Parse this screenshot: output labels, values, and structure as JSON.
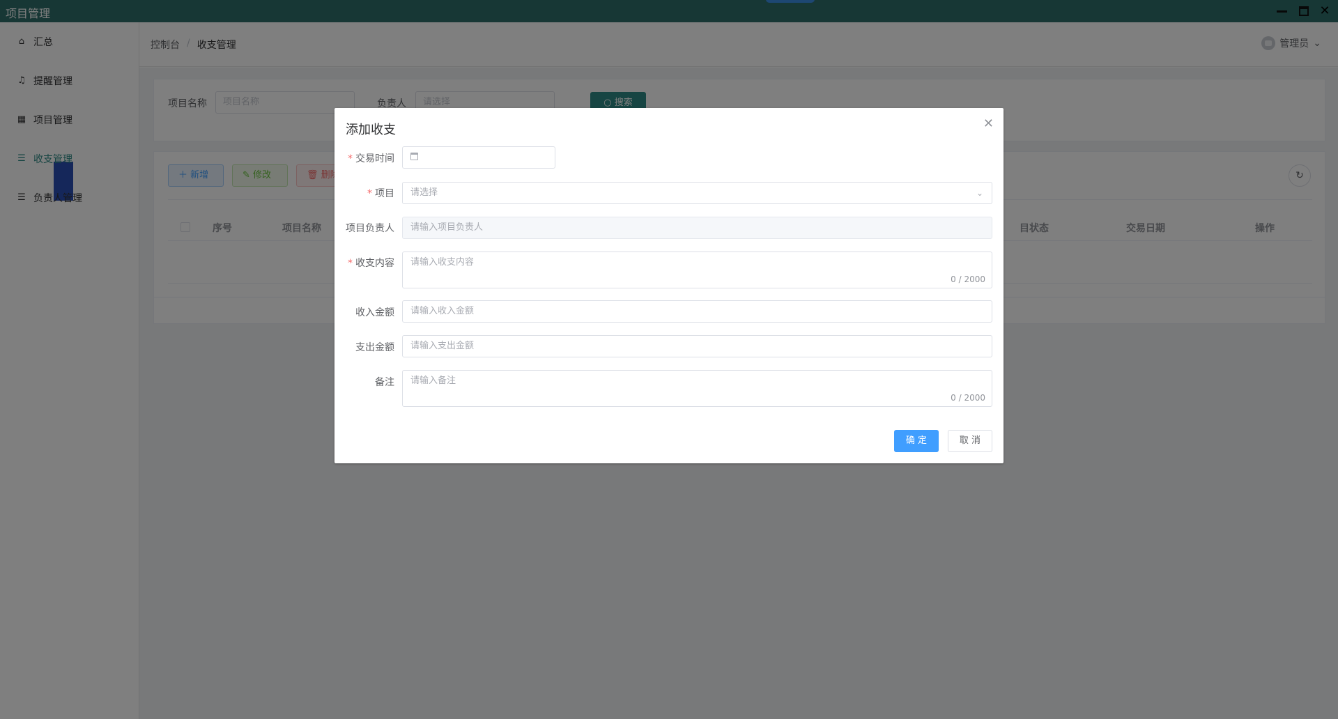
{
  "window": {
    "title": "项目管理"
  },
  "sidebar": {
    "items": [
      {
        "label": "汇总",
        "icon": "home-icon"
      },
      {
        "label": "提醒管理",
        "icon": "bell-icon"
      },
      {
        "label": "项目管理",
        "icon": "grid-icon"
      },
      {
        "label": "收支管理",
        "icon": "database-icon"
      },
      {
        "label": "负责人管理",
        "icon": "database-icon"
      }
    ]
  },
  "header": {
    "breadcrumb": [
      "控制台",
      "收支管理"
    ],
    "separator": "/",
    "user": "管理员"
  },
  "search": {
    "project_label": "项目名称",
    "project_placeholder": "项目名称",
    "owner_label": "负责人",
    "owner_placeholder": "请选择",
    "search_button": "搜索"
  },
  "toolbar": {
    "add": "新增",
    "edit": "修改",
    "delete": "删除"
  },
  "table": {
    "columns": [
      "序号",
      "项目名称",
      "目状态",
      "交易日期",
      "操作"
    ]
  },
  "dialog": {
    "title": "添加收支",
    "fields": {
      "trade_time_label": "交易时间",
      "project_label": "项目",
      "project_placeholder": "请选择",
      "owner_label": "项目负责人",
      "owner_placeholder": "请输入项目负责人",
      "content_label": "收支内容",
      "content_placeholder": "请输入收支内容",
      "content_count": "0 / 2000",
      "income_label": "收入金额",
      "income_placeholder": "请输入收入金额",
      "expense_label": "支出金额",
      "expense_placeholder": "请输入支出金额",
      "remark_label": "备注",
      "remark_placeholder": "请输入备注",
      "remark_count": "0 / 2000"
    },
    "ok_button": "确 定",
    "cancel_button": "取 消"
  }
}
